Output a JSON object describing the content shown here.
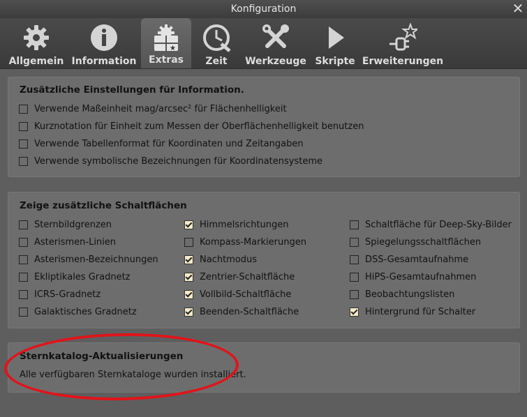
{
  "window": {
    "title": "Konfiguration",
    "close_glyph": "✕"
  },
  "tabs": [
    {
      "label": "Allgemein",
      "icon": "gear-icon",
      "active": false
    },
    {
      "label": "Information",
      "icon": "info-icon",
      "active": false
    },
    {
      "label": "Extras",
      "icon": "extras-icon",
      "active": true
    },
    {
      "label": "Zeit",
      "icon": "clock-icon",
      "active": false
    },
    {
      "label": "Werkzeuge",
      "icon": "tools-icon",
      "active": false
    },
    {
      "label": "Skripte",
      "icon": "play-icon",
      "active": false
    },
    {
      "label": "Erweiterungen",
      "icon": "plugin-icon",
      "active": false
    }
  ],
  "info_panel": {
    "title": "Zusätzliche Einstellungen für Information.",
    "options": [
      {
        "label": "Verwende Maßeinheit mag/arcsec² für Flächenhelligkeit",
        "checked": false
      },
      {
        "label": "Kurznotation für Einheit zum Messen der Oberflächenhelligkeit benutzen",
        "checked": false
      },
      {
        "label": "Verwende Tabellenformat für Koordinaten und Zeitangaben",
        "checked": false
      },
      {
        "label": "Verwende symbolische Bezeichnungen für Koordinatensysteme",
        "checked": false
      }
    ]
  },
  "buttons_panel": {
    "title": "Zeige zusätzliche Schaltflächen",
    "col1": [
      {
        "label": "Sternbildgrenzen",
        "checked": false
      },
      {
        "label": "Asterismen-Linien",
        "checked": false
      },
      {
        "label": "Asterismen-Bezeichnungen",
        "checked": false
      },
      {
        "label": "Ekliptikales Gradnetz",
        "checked": false
      },
      {
        "label": "ICRS-Gradnetz",
        "checked": false
      },
      {
        "label": "Galaktisches Gradnetz",
        "checked": false
      }
    ],
    "col2": [
      {
        "label": "Himmelsrichtungen",
        "checked": true
      },
      {
        "label": "Kompass-Markierungen",
        "checked": false
      },
      {
        "label": "Nachtmodus",
        "checked": true
      },
      {
        "label": "Zentrier-Schaltfläche",
        "checked": true
      },
      {
        "label": "Vollbild-Schaltfläche",
        "checked": true
      },
      {
        "label": "Beenden-Schaltfläche",
        "checked": true
      }
    ],
    "col3": [
      {
        "label": "Schaltfläche für Deep-Sky-Bilder",
        "checked": false
      },
      {
        "label": "Spiegelungsschaltflächen",
        "checked": false
      },
      {
        "label": "DSS-Gesamtaufnahme",
        "checked": false
      },
      {
        "label": "HiPS-Gesamtaufnahmen",
        "checked": false
      },
      {
        "label": "Beobachtungslisten",
        "checked": false
      },
      {
        "label": "Hintergrund für Schalter",
        "checked": true
      }
    ]
  },
  "catalog_panel": {
    "title": "Sternkatalog-Aktualisierungen",
    "text": "Alle verfügbaren Sternkataloge wurden installiert."
  },
  "colors": {
    "highlight_oval": "#e0141a",
    "checkbox_checked": "#f4e9c8"
  }
}
